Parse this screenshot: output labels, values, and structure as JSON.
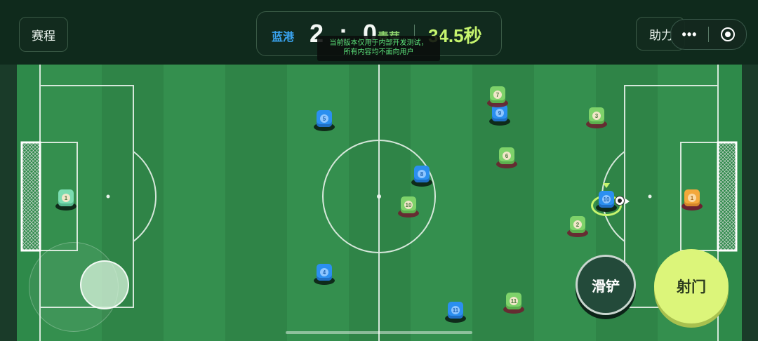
{
  "header": {
    "schedule_label": "赛程",
    "assist_label": "助力",
    "more_label": "•••"
  },
  "scoreboard": {
    "team_home": "蓝港",
    "score": "2 : 0",
    "team_away": "青芽",
    "timer": "34.5秒"
  },
  "notice": {
    "line1": "当前版本仅用于内部开发测试，",
    "line2": "所有内容均不面向用户"
  },
  "players": [
    {
      "team": "teal",
      "number": "1"
    },
    {
      "team": "blue",
      "number": "5"
    },
    {
      "team": "blue",
      "number": "4"
    },
    {
      "team": "blue",
      "number": "8"
    },
    {
      "team": "blue",
      "number": "9"
    },
    {
      "team": "blue",
      "number": "11"
    },
    {
      "team": "blue",
      "number": "10"
    },
    {
      "team": "green",
      "number": "10"
    },
    {
      "team": "green",
      "number": "7"
    },
    {
      "team": "green",
      "number": "6"
    },
    {
      "team": "green",
      "number": "3"
    },
    {
      "team": "green",
      "number": "2"
    },
    {
      "team": "green",
      "number": "11"
    },
    {
      "team": "orange",
      "number": "1"
    }
  ],
  "controls": {
    "tackle_label": "滑铲",
    "shoot_label": "射门"
  },
  "colors": {
    "home_team": "#3aa3ef",
    "away_team": "#8fd46e",
    "timer": "#c6f56e",
    "shoot_button": "#dcf57a"
  }
}
